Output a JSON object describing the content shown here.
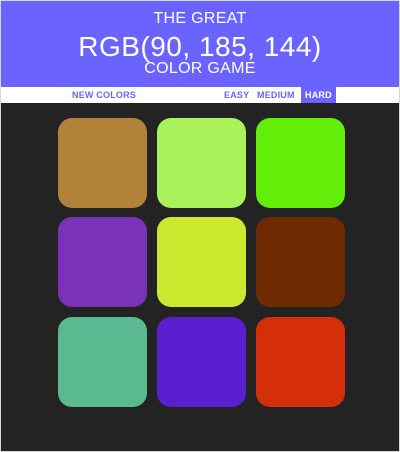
{
  "header": {
    "title_top": "THE GREAT",
    "rgb_display": "RGB(90, 185, 144)",
    "title_bottom": "COLOR GAME",
    "background_color": "#6b63ff"
  },
  "stripe": {
    "new_colors_label": "NEW COLORS",
    "modes": [
      {
        "label": "EASY",
        "selected": false
      },
      {
        "label": "MEDIUM",
        "selected": false
      },
      {
        "label": "HARD",
        "selected": true
      }
    ],
    "accent_color": "#6b63ff"
  },
  "board": {
    "background_color": "#232323",
    "squares": [
      {
        "color": "#b3823a"
      },
      {
        "color": "#aaf25a"
      },
      {
        "color": "#63ee0a"
      },
      {
        "color": "#7a33b8"
      },
      {
        "color": "#cce82f"
      },
      {
        "color": "#6e2a00"
      },
      {
        "color": "#5ab990"
      },
      {
        "color": "#5a20d0"
      },
      {
        "color": "#d42f08"
      }
    ]
  }
}
